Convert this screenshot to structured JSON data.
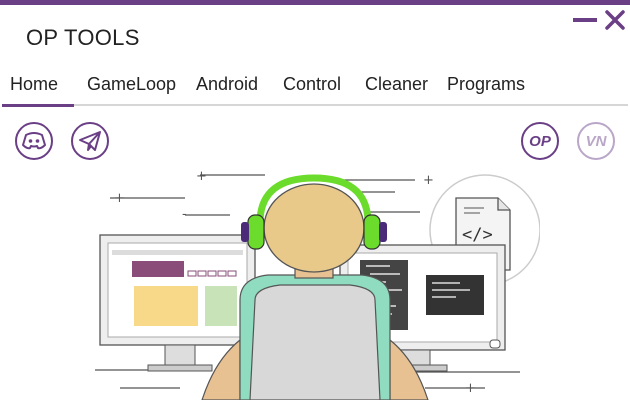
{
  "window": {
    "title": "OP TOOLS",
    "accent_color": "#6a3f86"
  },
  "tabs": [
    {
      "label": "Home",
      "active": true
    },
    {
      "label": "GameLoop",
      "active": false
    },
    {
      "label": "Android",
      "active": false
    },
    {
      "label": "Control",
      "active": false
    },
    {
      "label": "Cleaner",
      "active": false
    },
    {
      "label": "Programs",
      "active": false
    }
  ],
  "social": {
    "left": [
      {
        "icon": "discord-icon"
      },
      {
        "icon": "telegram-icon"
      }
    ],
    "right": [
      {
        "label": "OP"
      },
      {
        "label": "VN"
      }
    ]
  },
  "illustration": {
    "icon": "developer-at-computers-illustration",
    "code_badge": "</>"
  }
}
